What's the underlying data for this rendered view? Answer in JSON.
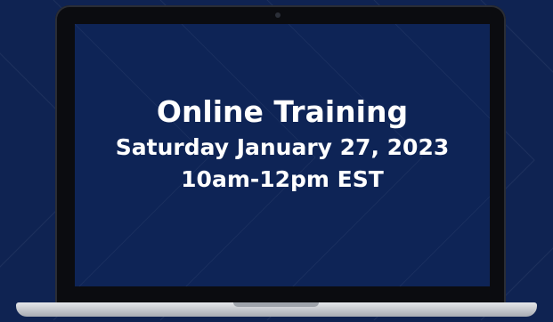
{
  "banner": {
    "title": "Online Training",
    "date": "Saturday January 27, 2023",
    "time": "10am-12pm EST"
  },
  "colors": {
    "background": "#0f2352",
    "screen": "#0e2456",
    "text": "#ffffff",
    "bezel": "#0b0c10"
  },
  "icons": {
    "device": "laptop-icon"
  }
}
